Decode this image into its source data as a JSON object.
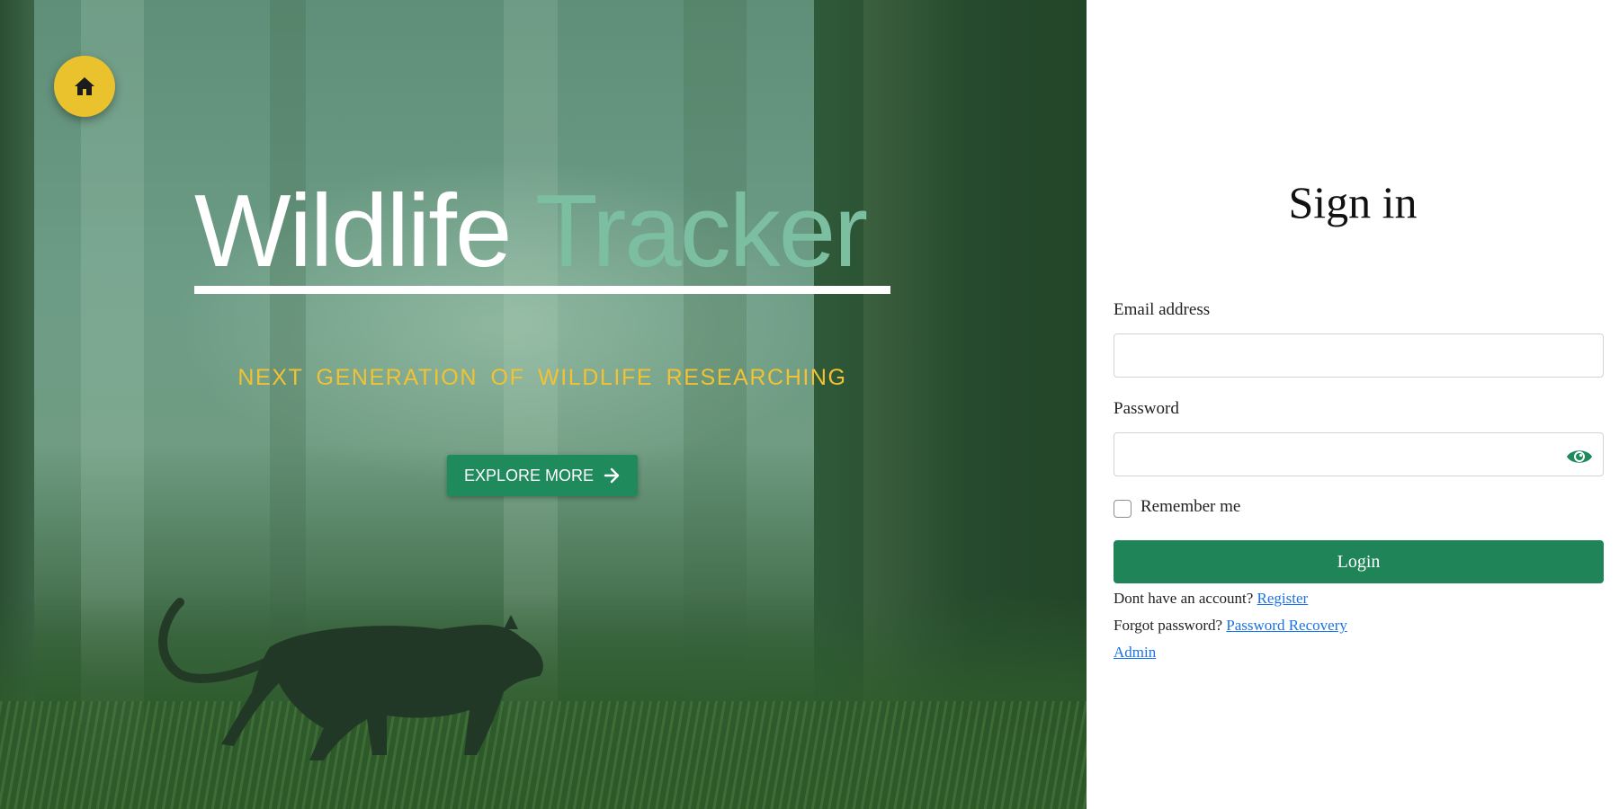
{
  "hero": {
    "title_main": "Wildlife",
    "title_accent": "Tracker",
    "subtitle": "NEXT GENERATION OF WILDLIFE RESEARCHING",
    "explore_button": "EXPLORE MORE",
    "home_icon": "home-icon",
    "arrow_icon": "arrow-right-icon"
  },
  "signin": {
    "title": "Sign in",
    "email_label": "Email address",
    "email_value": "",
    "password_label": "Password",
    "password_value": "",
    "password_toggle_icon": "eye-icon",
    "remember_label": "Remember me",
    "remember_checked": false,
    "login_button": "Login",
    "register_prompt": "Dont have an account?",
    "register_link": "Register",
    "forgot_prompt": "Forgot password?",
    "recovery_link": "Password Recovery",
    "admin_link": "Admin"
  },
  "colors": {
    "accent_green": "#1f8558",
    "title_accent": "#7cbfa0",
    "subtitle_gold": "#f2c233",
    "home_button_yellow": "#e9c22d",
    "link_blue": "#1a73e8"
  }
}
